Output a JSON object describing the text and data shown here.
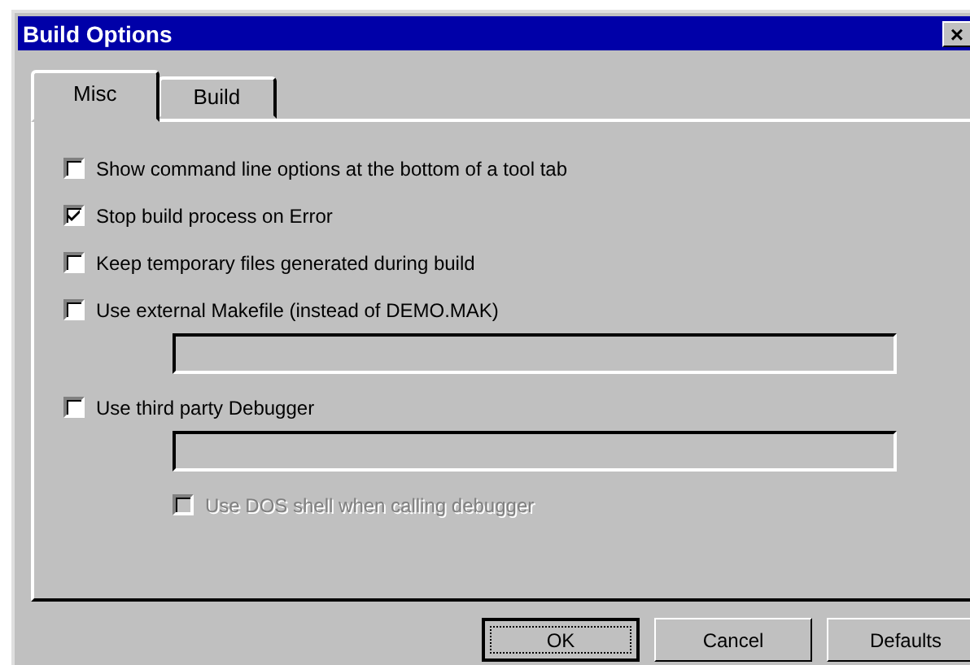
{
  "window": {
    "title": "Build Options",
    "close": "×"
  },
  "tabs": [
    {
      "label": "Misc",
      "selected": true
    },
    {
      "label": "Build",
      "selected": false
    }
  ],
  "options": [
    {
      "kind": "checkbox",
      "label": "Show command line options at the bottom of a tool tab",
      "checked": false,
      "disabled": false
    },
    {
      "kind": "checkbox",
      "label": "Stop build process on Error",
      "checked": true,
      "disabled": false
    },
    {
      "kind": "checkbox",
      "label": "Keep temporary files generated during build",
      "checked": false,
      "disabled": false
    },
    {
      "kind": "checkbox",
      "label": "Use external Makefile (instead of DEMO.MAK)",
      "checked": false,
      "disabled": false
    },
    {
      "kind": "field",
      "disabled": true
    },
    {
      "kind": "checkbox",
      "label": "Use third party Debugger",
      "checked": false,
      "disabled": false
    },
    {
      "kind": "field",
      "disabled": true
    },
    {
      "kind": "subcheckbox",
      "label": "Use DOS shell when calling debugger",
      "checked": false,
      "disabled": true
    }
  ],
  "buttons": [
    {
      "label": "OK",
      "default": true
    },
    {
      "label": "Cancel",
      "default": false
    },
    {
      "label": "Defaults",
      "default": false
    }
  ]
}
